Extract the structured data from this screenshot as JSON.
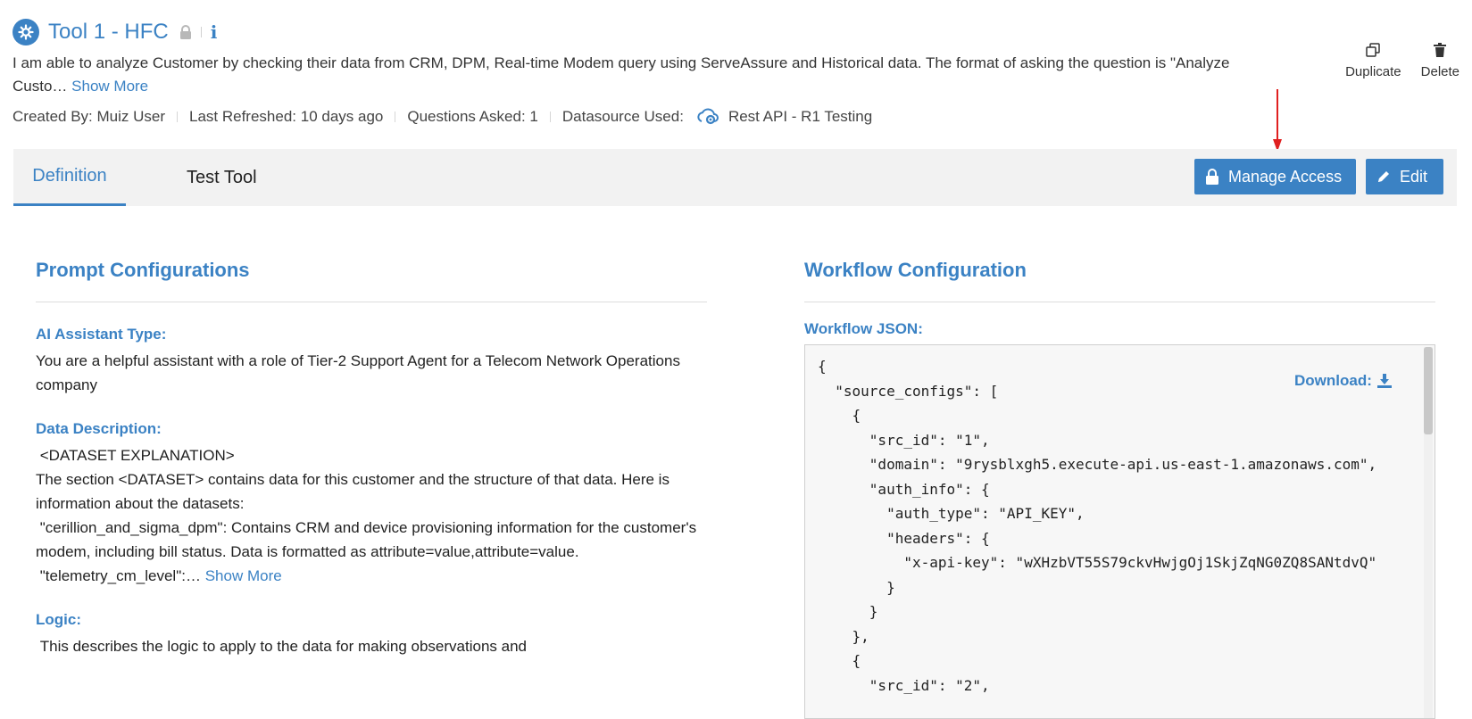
{
  "header": {
    "title": "Tool 1 - HFC",
    "description": "I am able to analyze Customer by checking their data from CRM, DPM, Real-time Modem query using ServeAssure and Historical data. The format of asking the question is \"Analyze Custo…",
    "show_more": "Show More",
    "meta": {
      "created_by": "Created By: Muiz User",
      "last_refreshed": "Last Refreshed: 10 days ago",
      "questions_asked": "Questions Asked: 1",
      "datasource_label": "Datasource Used:",
      "datasource_value": "Rest API - R1 Testing"
    },
    "actions": {
      "duplicate": "Duplicate",
      "delete": "Delete"
    }
  },
  "tabs": {
    "definition": "Definition",
    "test_tool": "Test Tool"
  },
  "buttons": {
    "manage_access": "Manage Access",
    "edit": "Edit"
  },
  "prompt": {
    "title": "Prompt Configurations",
    "ai_type_label": "AI Assistant Type:",
    "ai_type_value": "You are a helpful assistant with a role of Tier-2 Support Agent for a Telecom Network Operations company",
    "data_desc_label": "Data Description:",
    "data_desc_line1": " <DATASET EXPLANATION>",
    "data_desc_line2": "The section <DATASET> contains data for this customer and the structure of that data. Here is information about the datasets:",
    "data_desc_line3": " \"cerillion_and_sigma_dpm\": Contains CRM and device provisioning information for the customer's modem, including bill status. Data is formatted as attribute=value,attribute=value.",
    "data_desc_line4": " \"telemetry_cm_level\":…",
    "show_more": "Show More",
    "logic_label": "Logic:",
    "logic_value": " This describes the logic to apply to the data for making observations and"
  },
  "workflow": {
    "title": "Workflow Configuration",
    "json_label": "Workflow JSON:",
    "download": "Download:",
    "json_text": "{\n  \"source_configs\": [\n    {\n      \"src_id\": \"1\",\n      \"domain\": \"9rysblxgh5.execute-api.us-east-1.amazonaws.com\",\n      \"auth_info\": {\n        \"auth_type\": \"API_KEY\",\n        \"headers\": {\n          \"x-api-key\": \"wXHzbVT55S79ckvHwjgOj1SkjZqNG0ZQ8SANtdvQ\"\n        }\n      }\n    },\n    {\n      \"src_id\": \"2\","
  },
  "colors": {
    "accent": "#3b82c4",
    "tabbar_bg": "#f2f2f2",
    "annotation_arrow": "#e02020"
  },
  "icons": [
    "tool-logo-icon",
    "lock-icon",
    "info-icon",
    "datasource-icon",
    "duplicate-icon",
    "delete-icon",
    "download-icon",
    "pencil-icon",
    "annotation-arrow"
  ]
}
